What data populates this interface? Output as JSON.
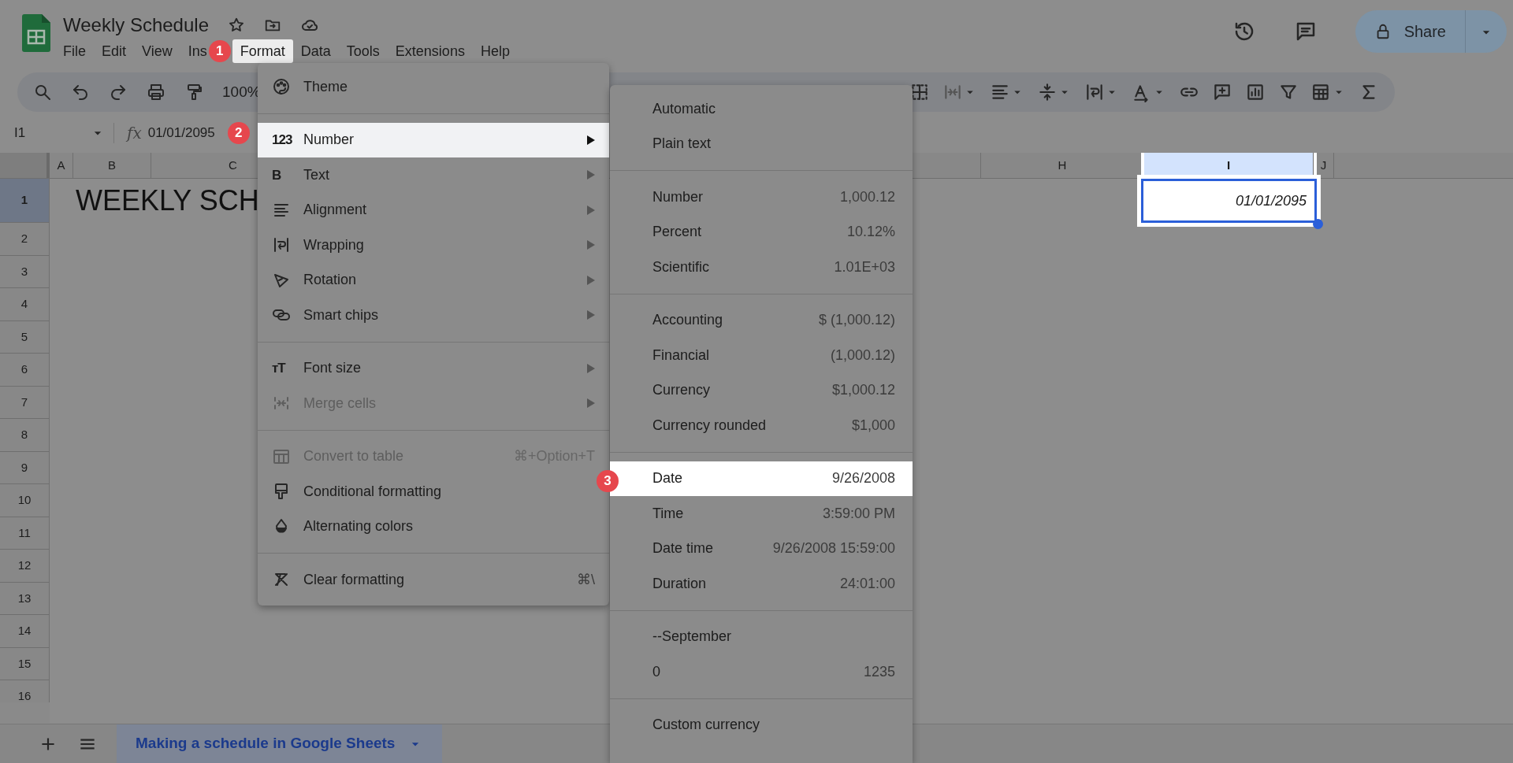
{
  "document": {
    "title": "Weekly Schedule"
  },
  "menu_bar": [
    {
      "label": "File",
      "selected": false
    },
    {
      "label": "Edit",
      "selected": false
    },
    {
      "label": "View",
      "selected": false
    },
    {
      "label": "Ins",
      "selected": false
    },
    {
      "label": "Format",
      "selected": true
    },
    {
      "label": "Data",
      "selected": false
    },
    {
      "label": "Tools",
      "selected": false
    },
    {
      "label": "Extensions",
      "selected": false
    },
    {
      "label": "Help",
      "selected": false
    }
  ],
  "toolbar": {
    "zoom": "100%"
  },
  "share_button": {
    "label": "Share"
  },
  "formula_bar": {
    "cell_ref": "I1",
    "function_label": "fx",
    "value": "01/01/2095"
  },
  "column_headers": [
    {
      "label": "A",
      "selected": false
    },
    {
      "label": "B",
      "selected": false
    },
    {
      "label": "C",
      "selected": false
    },
    {
      "label": "H",
      "selected": false
    },
    {
      "label": "I",
      "selected": true
    },
    {
      "label": "J",
      "selected": false
    }
  ],
  "row_headers": [
    {
      "label": "1",
      "selected": true
    },
    {
      "label": "2",
      "selected": false
    },
    {
      "label": "3",
      "selected": false
    },
    {
      "label": "4",
      "selected": false
    },
    {
      "label": "5",
      "selected": false
    },
    {
      "label": "6",
      "selected": false
    },
    {
      "label": "7",
      "selected": false
    },
    {
      "label": "8",
      "selected": false
    },
    {
      "label": "9",
      "selected": false
    },
    {
      "label": "10",
      "selected": false
    },
    {
      "label": "11",
      "selected": false
    },
    {
      "label": "12",
      "selected": false
    },
    {
      "label": "13",
      "selected": false
    },
    {
      "label": "14",
      "selected": false
    },
    {
      "label": "15",
      "selected": false
    },
    {
      "label": "16",
      "selected": false
    }
  ],
  "cells": {
    "b1": "WEEKLY SCH",
    "i1": {
      "text": "01/01/2095",
      "selected": true
    }
  },
  "format_menu": [
    [
      {
        "label": "Theme",
        "has_submenu": false,
        "disabled": false,
        "selected": false
      }
    ],
    [
      {
        "label": "Number",
        "glyph": "123",
        "has_submenu": true,
        "disabled": false,
        "selected": true
      },
      {
        "label": "Text",
        "glyph": "B",
        "has_submenu": true,
        "disabled": false,
        "selected": false
      },
      {
        "label": "Alignment",
        "has_submenu": true,
        "disabled": false,
        "selected": false
      },
      {
        "label": "Wrapping",
        "has_submenu": true,
        "disabled": false,
        "selected": false
      },
      {
        "label": "Rotation",
        "has_submenu": true,
        "disabled": false,
        "selected": false
      },
      {
        "label": "Smart chips",
        "has_submenu": true,
        "disabled": false,
        "selected": false
      }
    ],
    [
      {
        "label": "Font size",
        "glyph": "тT",
        "has_submenu": true,
        "disabled": false,
        "selected": false
      },
      {
        "label": "Merge cells",
        "has_submenu": true,
        "disabled": true,
        "selected": false
      }
    ],
    [
      {
        "label": "Convert to table",
        "shortcut": "⌘+Option+T",
        "has_submenu": false,
        "disabled": true,
        "selected": false
      },
      {
        "label": "Conditional formatting",
        "has_submenu": false,
        "disabled": false,
        "selected": false
      },
      {
        "label": "Alternating colors",
        "has_submenu": false,
        "disabled": false,
        "selected": false
      }
    ],
    [
      {
        "label": "Clear formatting",
        "shortcut": "⌘\\",
        "has_submenu": false,
        "disabled": false,
        "selected": false
      }
    ]
  ],
  "number_submenu": [
    [
      {
        "label": "Automatic",
        "selected": false
      },
      {
        "label": "Plain text",
        "selected": false
      }
    ],
    [
      {
        "label": "Number",
        "example": "1,000.12",
        "selected": false
      },
      {
        "label": "Percent",
        "example": "10.12%",
        "selected": false
      },
      {
        "label": "Scientific",
        "example": "1.01E+03",
        "selected": false
      }
    ],
    [
      {
        "label": "Accounting",
        "example": "$ (1,000.12)",
        "selected": false
      },
      {
        "label": "Financial",
        "example": "(1,000.12)",
        "selected": false
      },
      {
        "label": "Currency",
        "example": "$1,000.12",
        "selected": false
      },
      {
        "label": "Currency rounded",
        "example": "$1,000",
        "selected": false
      }
    ],
    [
      {
        "label": "Date",
        "example": "9/26/2008",
        "selected": true
      },
      {
        "label": "Time",
        "example": "3:59:00 PM",
        "selected": false
      },
      {
        "label": "Date time",
        "example": "9/26/2008 15:59:00",
        "selected": false
      },
      {
        "label": "Duration",
        "example": "24:01:00",
        "selected": false
      }
    ],
    [
      {
        "label": "--September",
        "selected": false
      },
      {
        "label": "0",
        "example": "1235",
        "selected": false
      }
    ],
    [
      {
        "label": "Custom currency",
        "selected": false
      }
    ]
  ],
  "callouts": [
    "1",
    "2",
    "3"
  ],
  "sheet_tabs": [
    {
      "label": "Making a schedule in Google Sheets",
      "selected": true
    }
  ]
}
